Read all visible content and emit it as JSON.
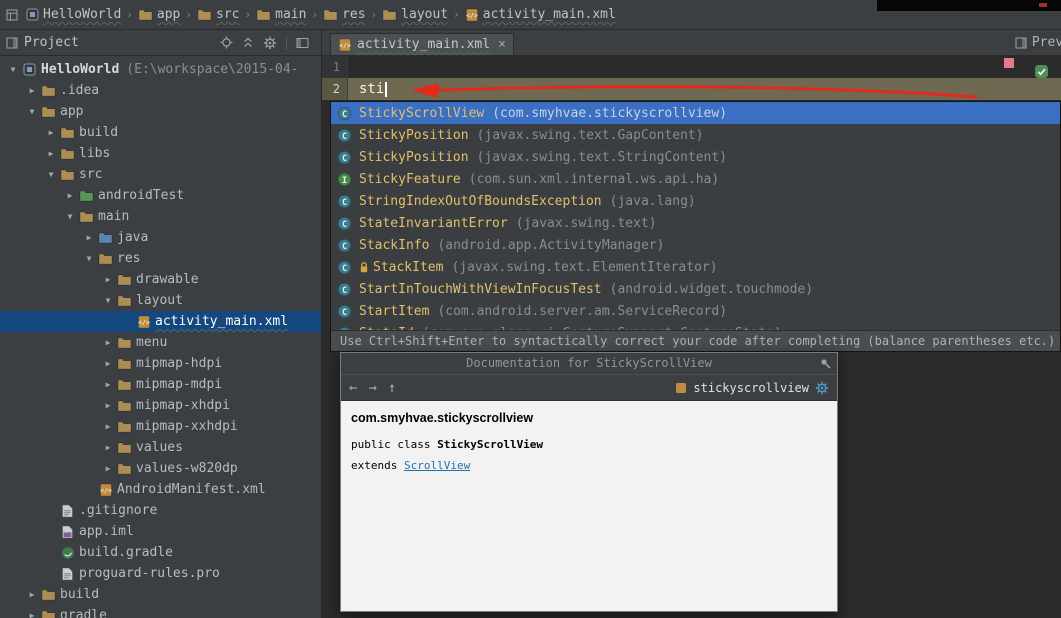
{
  "colors": {
    "list_selection": "#3b6fc4",
    "tree_selection": "#14477e",
    "class_name_text": "#e4bf6a",
    "package_text": "#8c8c8c",
    "doc_link": "#2470a8",
    "caret_line": "#6e6950",
    "error_stripe": "#e7798b",
    "annotation_arrow": "#e42a1d"
  },
  "icons": {
    "close": "×",
    "collapsed": "▶",
    "expanded": "▼",
    "separator": "›",
    "back": "←",
    "forward": "→",
    "up": "↑"
  },
  "nav": {
    "items": [
      {
        "label": "HelloWorld",
        "icon": "project"
      },
      {
        "label": "app",
        "icon": "folder"
      },
      {
        "label": "src",
        "icon": "folder"
      },
      {
        "label": "main",
        "icon": "folder"
      },
      {
        "label": "res",
        "icon": "folder"
      },
      {
        "label": "layout",
        "icon": "folder"
      },
      {
        "label": "activity_main.xml",
        "icon": "xml"
      }
    ]
  },
  "project_panel": {
    "title": "Project"
  },
  "tabs": {
    "active_tab": "activity_main.xml",
    "preview_label": "Previ"
  },
  "tree": {
    "items": [
      {
        "label": "HelloWorld",
        "suffix": "(E:\\workspace\\2015-04-",
        "depth": 0,
        "arrow": "expanded",
        "icon": "project",
        "bold": true
      },
      {
        "label": ".idea",
        "depth": 1,
        "arrow": "collapsed",
        "icon": "folder"
      },
      {
        "label": "app",
        "depth": 1,
        "arrow": "expanded",
        "icon": "module"
      },
      {
        "label": "build",
        "depth": 2,
        "arrow": "collapsed",
        "icon": "folder"
      },
      {
        "label": "libs",
        "depth": 2,
        "arrow": "collapsed",
        "icon": "folder"
      },
      {
        "label": "src",
        "depth": 2,
        "arrow": "expanded",
        "icon": "folder"
      },
      {
        "label": "androidTest",
        "depth": 3,
        "arrow": "collapsed",
        "icon": "folder-green"
      },
      {
        "label": "main",
        "depth": 3,
        "arrow": "expanded",
        "icon": "folder"
      },
      {
        "label": "java",
        "depth": 4,
        "arrow": "collapsed",
        "icon": "folder-blue"
      },
      {
        "label": "res",
        "depth": 4,
        "arrow": "expanded",
        "icon": "folder-res"
      },
      {
        "label": "drawable",
        "depth": 5,
        "arrow": "collapsed",
        "icon": "folder"
      },
      {
        "label": "layout",
        "depth": 5,
        "arrow": "expanded",
        "icon": "folder"
      },
      {
        "label": "activity_main.xml",
        "depth": 6,
        "arrow": "none",
        "icon": "xml",
        "selected": true
      },
      {
        "label": "menu",
        "depth": 5,
        "arrow": "collapsed",
        "icon": "folder"
      },
      {
        "label": "mipmap-hdpi",
        "depth": 5,
        "arrow": "collapsed",
        "icon": "folder"
      },
      {
        "label": "mipmap-mdpi",
        "depth": 5,
        "arrow": "collapsed",
        "icon": "folder"
      },
      {
        "label": "mipmap-xhdpi",
        "depth": 5,
        "arrow": "collapsed",
        "icon": "folder"
      },
      {
        "label": "mipmap-xxhdpi",
        "depth": 5,
        "arrow": "collapsed",
        "icon": "folder"
      },
      {
        "label": "values",
        "depth": 5,
        "arrow": "collapsed",
        "icon": "folder"
      },
      {
        "label": "values-w820dp",
        "depth": 5,
        "arrow": "collapsed",
        "icon": "folder"
      },
      {
        "label": "AndroidManifest.xml",
        "depth": 4,
        "arrow": "none",
        "icon": "manifest"
      },
      {
        "label": ".gitignore",
        "depth": 2,
        "arrow": "none",
        "icon": "text"
      },
      {
        "label": "app.iml",
        "depth": 2,
        "arrow": "none",
        "icon": "iml"
      },
      {
        "label": "build.gradle",
        "depth": 2,
        "arrow": "none",
        "icon": "gradle"
      },
      {
        "label": "proguard-rules.pro",
        "depth": 2,
        "arrow": "none",
        "icon": "text"
      },
      {
        "label": "build",
        "depth": 1,
        "arrow": "collapsed",
        "icon": "folder"
      },
      {
        "label": "gradle",
        "depth": 1,
        "arrow": "collapsed",
        "icon": "folder"
      }
    ]
  },
  "editor": {
    "lines": [
      {
        "num": "1",
        "text": ""
      },
      {
        "num": "2",
        "text": "sti"
      }
    ]
  },
  "completion": {
    "items": [
      {
        "name": "StickyScrollView",
        "package": "(com.smyhvae.stickyscrollview)",
        "kind": "class",
        "selected": true
      },
      {
        "name": "StickyPosition",
        "package": "(javax.swing.text.GapContent)",
        "kind": "class"
      },
      {
        "name": "StickyPosition",
        "package": "(javax.swing.text.StringContent)",
        "kind": "class"
      },
      {
        "name": "StickyFeature",
        "package": "(com.sun.xml.internal.ws.api.ha)",
        "kind": "interface"
      },
      {
        "name": "StringIndexOutOfBoundsException",
        "package": "(java.lang)",
        "kind": "class"
      },
      {
        "name": "StateInvariantError",
        "package": "(javax.swing.text)",
        "kind": "class"
      },
      {
        "name": "StackInfo",
        "package": "(android.app.ActivityManager)",
        "kind": "class"
      },
      {
        "name": "StackItem",
        "package": "(javax.swing.text.ElementIterator)",
        "kind": "class",
        "lock": true
      },
      {
        "name": "StartInTouchWithViewInFocusTest",
        "package": "(android.widget.touchmode)",
        "kind": "class"
      },
      {
        "name": "StartItem",
        "package": "(com.android.server.am.ServiceRecord)",
        "kind": "class"
      },
      {
        "name": "StateId",
        "package": "(com.sun.glass.ui.GestureSupport.GestureState)",
        "kind": "class"
      }
    ],
    "hint": "Use Ctrl+Shift+Enter to syntactically correct your code after completing (balance parentheses etc.)"
  },
  "doc": {
    "title": "Documentation for StickyScrollView",
    "search_text": "stickyscrollview",
    "package_line": "com.smyhvae.stickyscrollview",
    "decl_prefix": "public class ",
    "decl_name": "StickyScrollView",
    "extends_prefix": "extends ",
    "extends_link": "ScrollView"
  }
}
